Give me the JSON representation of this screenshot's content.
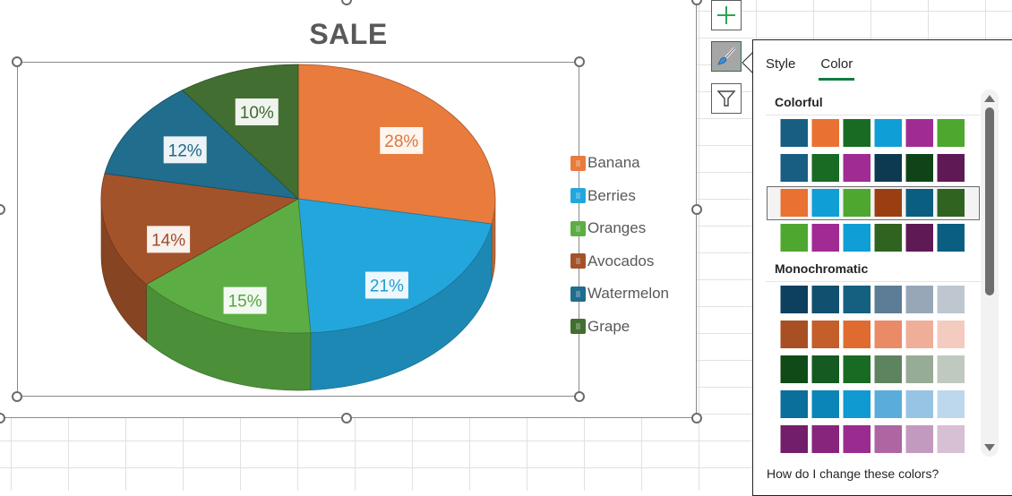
{
  "chart_data": {
    "type": "pie",
    "title": "SALE",
    "categories": [
      "Banana",
      "Berries",
      "Oranges",
      "Avocados",
      "Watermelon",
      "Grape"
    ],
    "values": [
      28,
      21,
      15,
      14,
      12,
      10
    ],
    "data_labels": [
      "28%",
      "21%",
      "15%",
      "14%",
      "12%",
      "10%"
    ],
    "colors": [
      "#e97b3c",
      "#23a6dc",
      "#5cae44",
      "#a3532a",
      "#216d8d",
      "#426f31"
    ],
    "legend_position": "right",
    "style": "3d"
  },
  "side_buttons": [
    {
      "name": "chart-elements",
      "icon": "plus-icon"
    },
    {
      "name": "chart-styles",
      "icon": "brush-icon"
    },
    {
      "name": "chart-filters",
      "icon": "filter-icon"
    }
  ],
  "panel": {
    "tabs": [
      {
        "label": "Style",
        "active": false
      },
      {
        "label": "Color",
        "active": true
      }
    ],
    "sections": [
      {
        "title": "Colorful",
        "rows": [
          [
            "#175e82",
            "#e97132",
            "#196b24",
            "#0f9ed5",
            "#a02b93",
            "#4ea72e"
          ],
          [
            "#175e82",
            "#196b24",
            "#a02b93",
            "#0e3a51",
            "#0f4419",
            "#5f1a56"
          ],
          [
            "#e97132",
            "#0f9ed5",
            "#4ea72e",
            "#9a3f12",
            "#0a5e80",
            "#2f631f"
          ],
          [
            "#4ea72e",
            "#a02b93",
            "#0f9ed5",
            "#2f631f",
            "#5f1a56",
            "#0a5e80"
          ]
        ],
        "selected_row": 2
      },
      {
        "title": "Monochromatic",
        "rows": [
          [
            "#0d3f5e",
            "#11506e",
            "#155f80",
            "#5d7d97",
            "#97a7b7",
            "#bec6d0"
          ],
          [
            "#a84f23",
            "#c45e2b",
            "#df6b31",
            "#ea8a67",
            "#efae98",
            "#f4cbbf"
          ],
          [
            "#104b17",
            "#155a20",
            "#196b24",
            "#5e835f",
            "#97ac96",
            "#bfc9bf"
          ],
          [
            "#0a6f9b",
            "#0b85b8",
            "#0f9ad2",
            "#5aaddb",
            "#97c4e4",
            "#bdd8ed"
          ],
          [
            "#731e6a",
            "#87257d",
            "#9b2c8f",
            "#ad66a2",
            "#c39abf",
            "#d7bfd4"
          ]
        ]
      }
    ],
    "help_link": "How do I change these colors?"
  }
}
